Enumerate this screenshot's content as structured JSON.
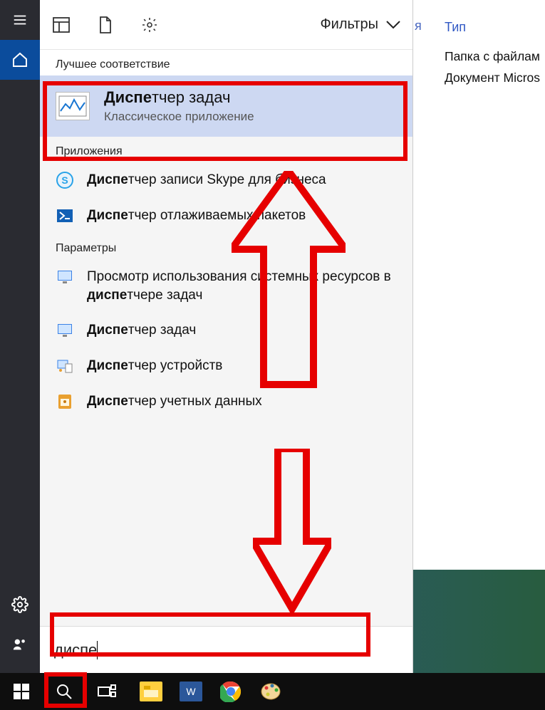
{
  "explorer": {
    "hanging_letter": "я",
    "column_header": "Тип",
    "rows": [
      "Папка с файлам",
      "Документ Micros"
    ]
  },
  "panel": {
    "filters_label": "Фильтры",
    "best_match_header": "Лучшее соответствие",
    "best_match": {
      "title_bold": "Диспе",
      "title_rest": "тчер задач",
      "subtitle": "Классическое приложение"
    },
    "apps_header": "Приложения",
    "apps": [
      {
        "icon": "skype-icon",
        "bold": "Диспе",
        "rest": "тчер записи Skype для бизнеса"
      },
      {
        "icon": "powershell-icon",
        "bold": "Диспе",
        "rest": "тчер отлаживаемых пакетов"
      }
    ],
    "settings_header": "Параметры",
    "settings": [
      {
        "icon": "monitor-icon",
        "pre": "Просмотр использования системных ресурсов в ",
        "bold": "диспе",
        "post": "тчере задач"
      },
      {
        "icon": "monitor-icon",
        "pre": "",
        "bold": "Диспе",
        "post": "тчер задач"
      },
      {
        "icon": "devices-icon",
        "pre": "",
        "bold": "Диспе",
        "post": "тчер устройств"
      },
      {
        "icon": "credentials-icon",
        "pre": "",
        "bold": "Диспе",
        "post": "тчер учетных данных"
      }
    ],
    "search_value": "диспе"
  },
  "taskbar": {
    "start": "start",
    "search": "search",
    "taskview": "taskview"
  }
}
